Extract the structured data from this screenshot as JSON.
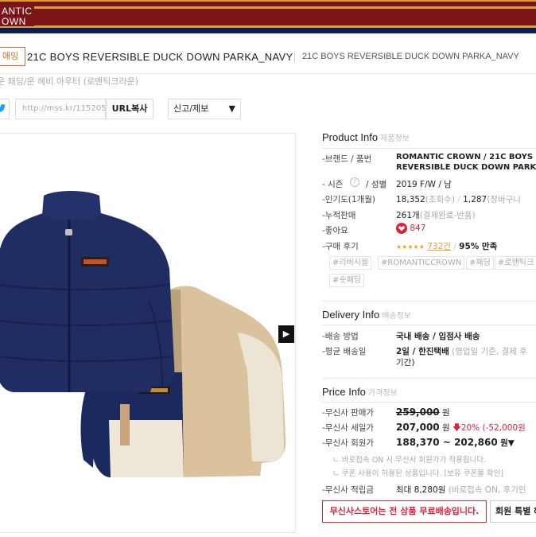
{
  "banner": {
    "logo_line1": "ANTIC",
    "logo_line2": "OWN"
  },
  "title": {
    "category_badge": "애잉",
    "product_name": "21C BOYS REVERSIBLE DUCK DOWN PARKA_NAVY",
    "product_sub": "21C BOYS REVERSIBLE DUCK DOWN PARKA_NAVY"
  },
  "breadcrumb": "운 패딩/운 헤비 아우터 (로맨틱크라운)",
  "share": {
    "twitter_icon": "t",
    "url": "http://mss.kr/115205",
    "url_copy_label": "URL복사",
    "report_label": "신고/제보"
  },
  "product_info": {
    "title": "Product Info",
    "title_ko": "제품정보",
    "brand_label": "-브랜드  /  품번",
    "brand_value": "ROMANTIC CROWN  /  21C BOYS",
    "brand_value2": "REVERSIBLE DUCK DOWN PARK",
    "season_label": "- 시즌",
    "season_gender_label": "/  성별",
    "season_value": "2019 F/W  /  남",
    "popularity_label": "-인기도(1개월)",
    "popularity_views": "18,352",
    "popularity_views_unit": "(조회수)",
    "popularity_cart": "1,287",
    "popularity_cart_unit": "(장바구니",
    "sales_label": "-누적판매",
    "sales_value": "261개",
    "sales_unit": "(결제완료-반품)",
    "likes_label": "-좋아요",
    "likes_value": "847",
    "review_label": "-구매 후기",
    "review_stars": "★★★★★",
    "review_count": "732건",
    "review_satisfaction": "95% 만족",
    "tags": [
      "#리버시블",
      "#ROMANTICCROWN",
      "#패딩",
      "#로맨틱크",
      "#숏패딩"
    ]
  },
  "delivery_info": {
    "title": "Delivery Info",
    "title_ko": "배송정보",
    "method_label": "-배송 방법",
    "method_value": "국내 배송  /  입점사 배송",
    "avg_label": "-평균 배송일",
    "avg_value": "2일  /  한진택배",
    "avg_note": "(영업일 기준, 결제 후",
    "avg_note2": "기간)"
  },
  "price_info": {
    "title": "Price Info",
    "title_ko": "가격정보",
    "retail_label": "-무신사 판매가",
    "retail_value": "259,000",
    "retail_unit": "원",
    "sale_label": "-무신사 세일가",
    "sale_value": "207,000",
    "sale_unit": "원",
    "sale_discount": "20%",
    "sale_amount": "(-52,000원",
    "member_label": "-무신사 회원가",
    "member_value": "188,370 ~ 202,860",
    "member_unit": "원▼",
    "note1": "ㄴ 바로접속 ON 시 무신사 회원가가 적용됩니다.",
    "note2": "ㄴ 쿠폰 사용이 허용된 상품입니다. [보유 쿠폰몰 확인]",
    "points_label": "-무신사 적립금",
    "points_value": "최대 8,280원",
    "points_note": "(바로접속 ON, 후기인",
    "free_shipping_notice": "무신사스토어는 전 상품 무료배송입니다.",
    "member_benefit": "회원 특별 혜"
  },
  "colors": {
    "banner_red": "#7a1418",
    "gold": "#d9a422",
    "accent_red": "#e0213b",
    "navy": "#1b2a5e",
    "beige": "#d8bf98"
  }
}
